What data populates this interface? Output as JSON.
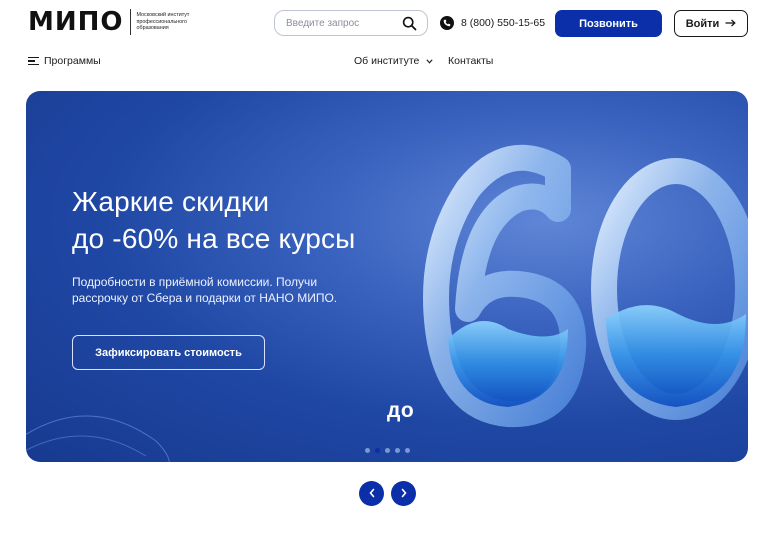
{
  "header": {
    "logo_text": "МИПО",
    "logo_subtitle": [
      "Московский институт",
      "профессионального",
      "образования"
    ],
    "search_placeholder": "Введите запрос",
    "phone": "8 (800) 550-15-65",
    "call_button": "Позвонить",
    "login_button": "Войти",
    "accent_color": "#0a2fa8"
  },
  "nav": {
    "programs": "Программы",
    "about": "Об институте",
    "contacts": "Контакты"
  },
  "banner": {
    "title_lines": [
      "Жаркие скидки",
      "до -60% на все курсы"
    ],
    "description_lines": [
      "Подробности в приёмной комиссии. Получи",
      "рассрочку от Сбера и подарки от НАНО МИПО."
    ],
    "cta_button": "Зафиксировать стоимость",
    "prefix_label": "до",
    "big_number": "60",
    "slides_total": 5,
    "active_slide": 2
  },
  "icons": {
    "search": "search-icon",
    "phone": "phone-icon",
    "menu": "menu-icon",
    "chevron": "chevron-down-icon",
    "login_arrow": "arrow-right-icon",
    "prev": "chevron-left-icon",
    "next": "chevron-right-icon"
  }
}
